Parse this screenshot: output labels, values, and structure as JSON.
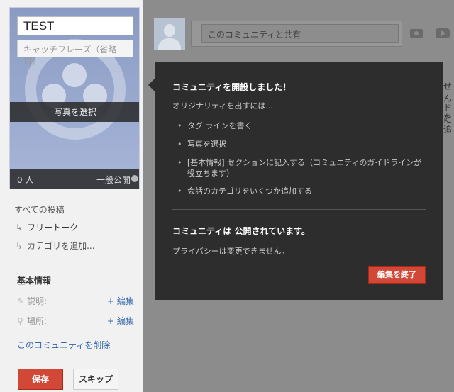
{
  "cover": {
    "name_value": "TEST",
    "tagline_placeholder": "キャッチフレーズ（省略可）",
    "select_photo_label": "写真を選択",
    "member_count": "0 人",
    "visibility_label": "一般公開"
  },
  "sidebar": {
    "all_posts_label": "すべての投稿",
    "categories": [
      {
        "arrow": "↳",
        "label": "フリートーク"
      },
      {
        "arrow": "↳",
        "label": "カテゴリを追加..."
      }
    ],
    "basic_info_heading": "基本情報",
    "description_label": "説明:",
    "location_label": "場所:",
    "edit_label": "+ 編集",
    "delete_label": "このコミュニティを削除",
    "save_label": "保存",
    "skip_label": "スキップ"
  },
  "share": {
    "placeholder": "このコミュニティと共有"
  },
  "background_fragments": [
    "せん",
    "ドに",
    "を追"
  ],
  "popup": {
    "title": "コミュニティを開設しました！",
    "intro": "オリジナリティを出すには...",
    "tips": [
      "タグ ラインを書く",
      "写真を選択",
      "[基本情報] セクションに記入する（コミュニティのガイドラインが役立ちます）",
      "会話のカテゴリをいくつか追加する"
    ],
    "status": "コミュニティは 公開されています。",
    "privacy_note": "プライバシーは変更できません。",
    "finish_label": "編集を終了"
  },
  "colors": {
    "accent_red": "#d14836",
    "link_blue": "#3366aa",
    "popup_bg": "#2d2d2d",
    "overlay_gray": "#8c8c8c"
  }
}
